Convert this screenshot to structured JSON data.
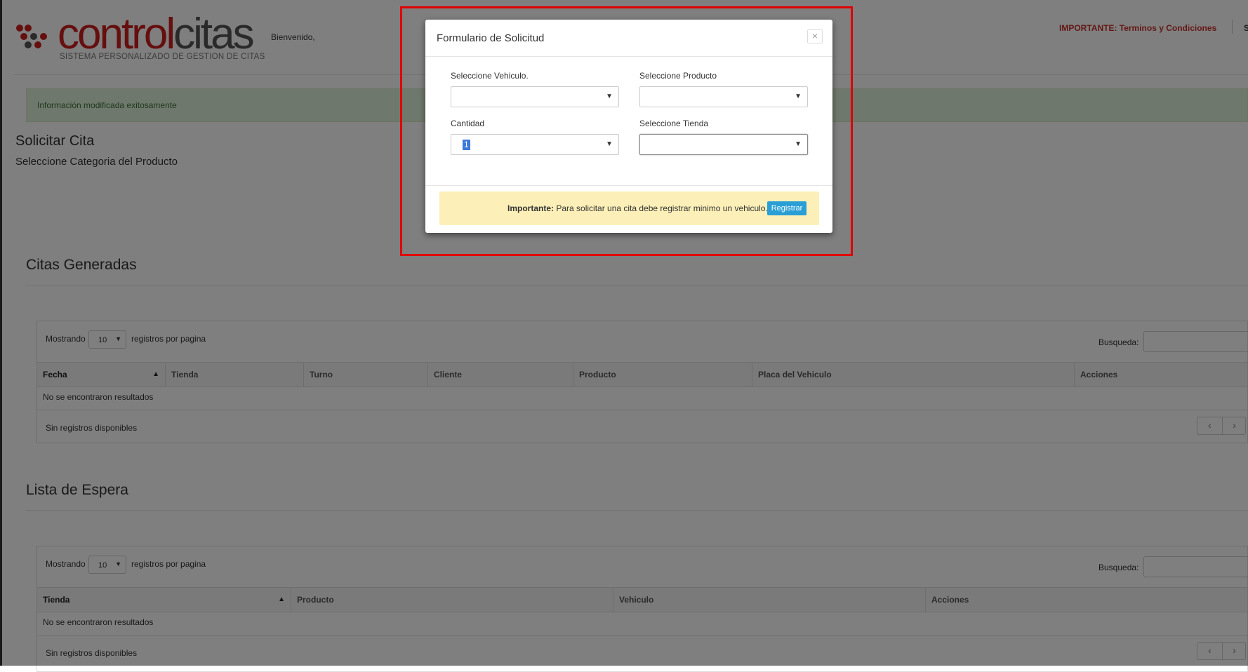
{
  "header": {
    "logo_part1": "control",
    "logo_part2": "citas",
    "logo_tagline": "SISTEMA PERSONALIZADO DE GESTION DE CITAS",
    "welcome": "Bienvenido,",
    "important_link": "IMPORTANTE: Terminos y Condiciones",
    "extra": "S"
  },
  "alert": {
    "message": "Información modificada exitosamente"
  },
  "page": {
    "title": "Solicitar Cita",
    "subtitle": "Seleccione Categoria del Producto"
  },
  "citas": {
    "title": "Citas Generadas",
    "show_label": "Mostrando",
    "page_size": "10",
    "per_page_label": "registros por pagina",
    "search_label": "Busqueda:",
    "columns": [
      "Fecha",
      "Tienda",
      "Turno",
      "Cliente",
      "Producto",
      "Placa del Vehiculo",
      "Acciones"
    ],
    "empty": "No se encontraron resultados",
    "info": "Sin registros disponibles",
    "prev": "‹",
    "next": "›"
  },
  "espera": {
    "title": "Lista de Espera",
    "show_label": "Mostrando",
    "page_size": "10",
    "per_page_label": "registros por pagina",
    "search_label": "Busqueda:",
    "columns": [
      "Tienda",
      "Producto",
      "Vehiculo",
      "Acciones"
    ],
    "empty": "No se encontraron resultados",
    "info": "Sin registros disponibles",
    "prev": "‹",
    "next": "›"
  },
  "modal": {
    "title": "Formulario de Solicitud",
    "close": "×",
    "vehiculo_label": "Seleccione Vehiculo.",
    "vehiculo_value": "",
    "producto_label": "Seleccione Producto",
    "producto_value": "",
    "cantidad_label": "Cantidad",
    "cantidad_value": "1",
    "tienda_label": "Seleccione Tienda",
    "tienda_value": "",
    "warning_strong": "Importante:",
    "warning_text": " Para solicitar una cita debe registrar minimo un vehiculo.",
    "register_button": "Registrar"
  },
  "colors": {
    "brand_red": "#cc1f1f",
    "alert_green": "#dff0d8",
    "warning_yellow": "#fcf0b8",
    "button_blue": "#2a9fd6",
    "highlight_red": "#e00000"
  }
}
